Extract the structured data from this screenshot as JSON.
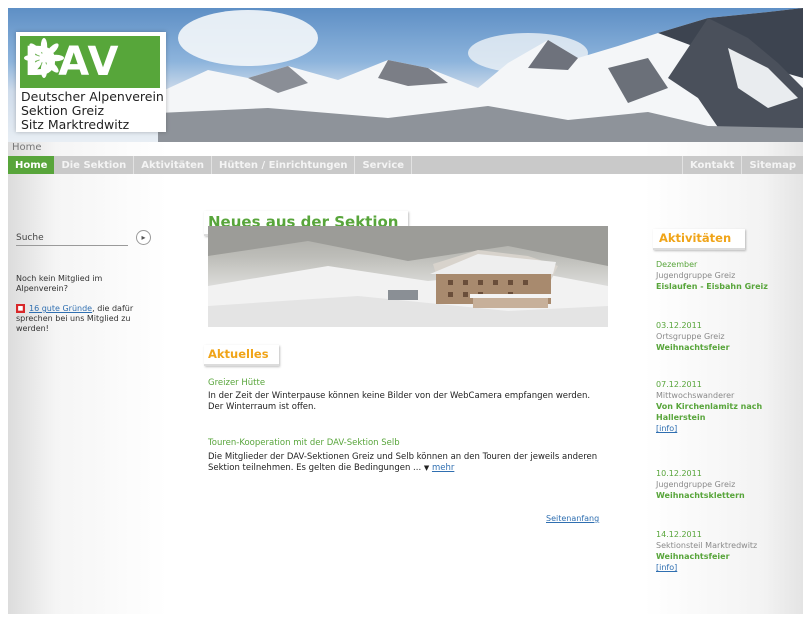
{
  "logo": {
    "abbr": "DAV",
    "line1": "Deutscher Alpenverein",
    "line2": "Sektion Greiz",
    "line3": "Sitz Marktredwitz"
  },
  "breadcrumb": "Home",
  "nav": {
    "items": [
      "Home",
      "Die Sektion",
      "Aktivitäten",
      "Hütten / Einrichtungen",
      "Service"
    ],
    "right": [
      "Kontakt",
      "Sitemap"
    ],
    "active_color": "#58a53b"
  },
  "sidebar": {
    "search_placeholder": "Suche",
    "member_question": "Noch kein Mitglied im Alpenverein?",
    "reasons_link": "16 gute Gründe",
    "reasons_text": ", die dafür sprechen bei uns Mitglied zu werden!"
  },
  "main": {
    "heading": "Neues aus der Sektion",
    "news_heading": "Aktuelles",
    "news": [
      {
        "title": "Greizer Hütte",
        "text": "In der Zeit der Winterpause können keine Bilder von der WebCamera empfangen werden. Der Winterraum ist offen."
      },
      {
        "title": "Touren-Kooperation mit der DAV-Sektion Selb",
        "text": "Die Mitglieder der DAV-Sektionen Greiz und Selb können an den Touren der jeweils anderen Sektion teilnehmen. Es gelten die Bedingungen ...",
        "more": "mehr"
      }
    ],
    "page_top": "Seitenanfang"
  },
  "activities": {
    "heading": "Aktivitäten",
    "items": [
      {
        "date": "Dezember",
        "group": "Jugendgruppe Greiz",
        "title": "Eislaufen - Eisbahn Greiz",
        "info": ""
      },
      {
        "date": "03.12.2011",
        "group": "Ortsgruppe Greiz",
        "title": "Weihnachtsfeier",
        "info": ""
      },
      {
        "date": "07.12.2011",
        "group": "Mittwochswanderer",
        "title": "Von Kirchenlamitz nach Hallerstein",
        "info": "[info]"
      },
      {
        "date": "10.12.2011",
        "group": "Jugendgruppe Greiz",
        "title": "Weihnachtsklettern",
        "info": ""
      },
      {
        "date": "14.12.2011",
        "group": "Sektionsteil Marktredwitz",
        "title": "Weihnachtsfeier",
        "info": "[info]"
      }
    ]
  },
  "colors": {
    "brand_green": "#58a53b",
    "accent_orange": "#f0a418",
    "link_blue": "#2f6fb1"
  }
}
